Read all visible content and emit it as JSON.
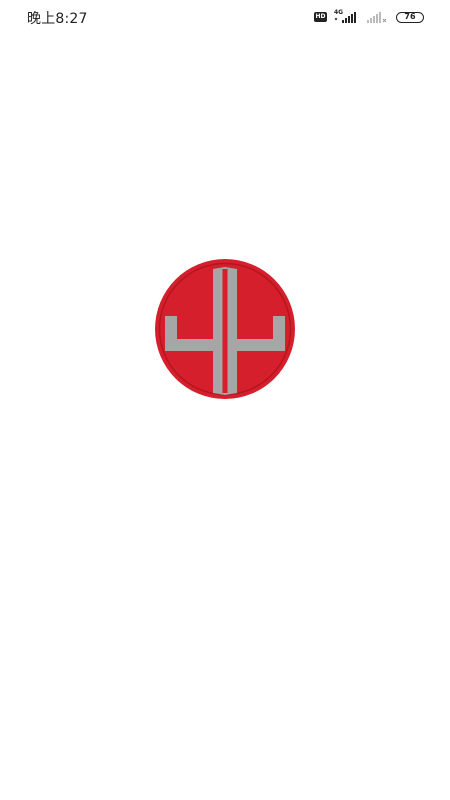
{
  "status_bar": {
    "time": "晚上8:27",
    "hd_badge": "HD",
    "network_type": "4G",
    "battery_level": "76",
    "icons": [
      "hd-icon",
      "signal-4g-icon",
      "signal-no-service-icon",
      "battery-icon"
    ]
  },
  "splash": {
    "logo": {
      "icon": "ye-logo-icon",
      "lettering": "YE",
      "colors": {
        "ring": "#d61f2c",
        "letters": "#a6a6a6",
        "background": "#ffffff"
      }
    }
  }
}
